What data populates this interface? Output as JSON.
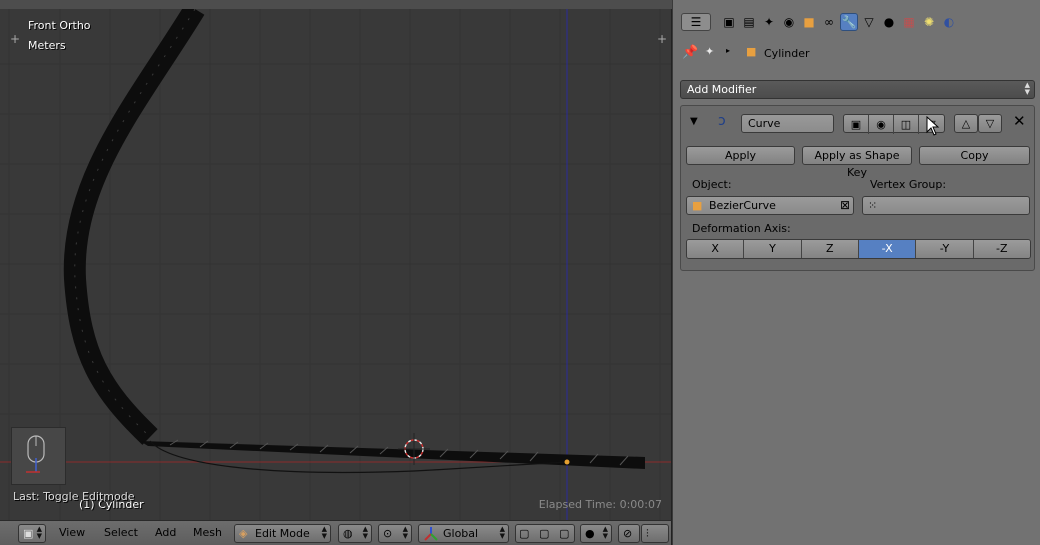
{
  "viewport": {
    "view_name": "Front Ortho",
    "units": "Meters",
    "object_info": "(1) Cylinder",
    "elapsed": "Elapsed Time: 0:00:07",
    "last_operator": "Last: Toggle Editmode"
  },
  "header": {
    "menus": [
      "View",
      "Select",
      "Add",
      "Mesh"
    ],
    "mode": "Edit Mode",
    "orientation": "Global"
  },
  "properties": {
    "context_object": "Cylinder",
    "add_modifier_label": "Add Modifier",
    "modifier": {
      "name": "Curve",
      "apply_label": "Apply",
      "apply_shape_label": "Apply as Shape Key",
      "copy_label": "Copy",
      "object_label": "Object:",
      "object_value": "BezierCurve",
      "vertex_group_label": "Vertex Group:",
      "vertex_group_value": "",
      "deformation_axis_label": "Deformation Axis:",
      "axes": [
        "X",
        "Y",
        "Z",
        "-X",
        "-Y",
        "-Z"
      ],
      "active_axis": "-X"
    }
  },
  "colors": {
    "accent": "#5680c2",
    "panel_bg": "#727272",
    "viewport_bg": "#393939"
  }
}
